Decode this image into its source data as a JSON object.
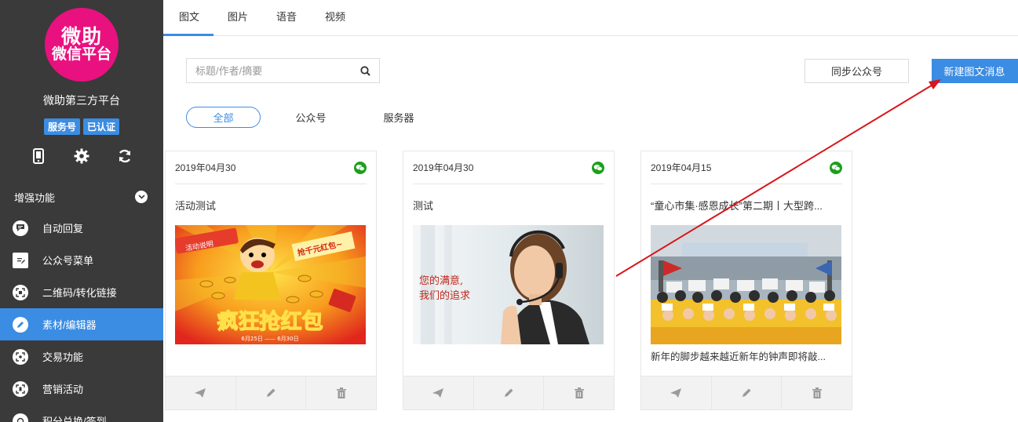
{
  "sidebar": {
    "logo_line1": "微助",
    "logo_line2": "微信平台",
    "app_name": "微助第三方平台",
    "badges": [
      "服务号",
      "已认证"
    ],
    "icons": [
      "phone-icon",
      "gear-icon",
      "refresh-icon"
    ],
    "group_title": "增强功能",
    "items": [
      {
        "label": "自动回复",
        "icon": "chat-bubble-icon",
        "active": false
      },
      {
        "label": "公众号菜单",
        "icon": "document-edit-icon",
        "active": false
      },
      {
        "label": "二维码/转化链接",
        "icon": "qrcode-icon",
        "active": false
      },
      {
        "label": "素材/编辑器",
        "icon": "pencil-icon",
        "active": true
      },
      {
        "label": "交易功能",
        "icon": "trade-icon",
        "active": false
      },
      {
        "label": "营销活动",
        "icon": "marketing-icon",
        "active": false
      },
      {
        "label": "积分兑换/签到",
        "icon": "points-icon",
        "active": false
      }
    ]
  },
  "tabs": [
    "图文",
    "图片",
    "语音",
    "视频"
  ],
  "search": {
    "placeholder": "标题/作者/摘要"
  },
  "buttons": {
    "sync": "同步公众号",
    "new": "新建图文消息"
  },
  "filters": [
    "全部",
    "公众号",
    "服务器"
  ],
  "cards": [
    {
      "date": "2019年04月30",
      "title": "活动测试",
      "image_text": {
        "tag": "活动说明",
        "banner": "抢千元红包~",
        "headline": "疯狂抢红包",
        "dates": "6月25日 —— 6月30日"
      },
      "digest": ""
    },
    {
      "date": "2019年04月30",
      "title": "测试",
      "image_text": {
        "line1": "您的满意,",
        "line2": "我们的追求"
      },
      "digest": ""
    },
    {
      "date": "2019年04月15",
      "title": "“童心市集·感恩成长”第二期丨大型跨...",
      "image_text": {},
      "digest": "新年的脚步越来越近新年的钟声即将敲..."
    }
  ],
  "colors": {
    "accent": "#3b8ce3",
    "sidebar_bg": "#3a3a3a",
    "logo": "#e8117f",
    "wechat": "#1ba01b",
    "arrow": "#d9151b"
  }
}
